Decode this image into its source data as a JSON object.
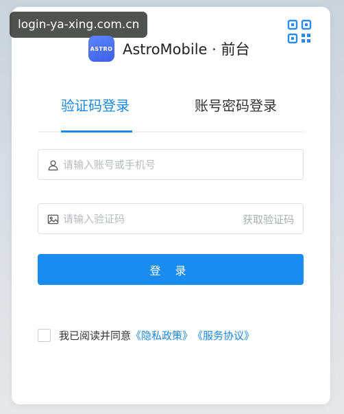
{
  "watermark": "login-ya-xing.com.cn",
  "header": {
    "logo_text": "ASTRO",
    "app_name": "AstroMobile · 前台"
  },
  "tabs": [
    {
      "label": "验证码登录",
      "active": true
    },
    {
      "label": "账号密码登录",
      "active": false
    }
  ],
  "form": {
    "account_placeholder": "请输入账号或手机号",
    "code_placeholder": "请输入验证码",
    "get_code_label": "获取验证码",
    "login_button": "登 录"
  },
  "agreement": {
    "prefix": "我已阅读并同意",
    "privacy_link": "《隐私政策》",
    "service_link": "《服务协议》",
    "checked": false
  },
  "colors": {
    "accent": "#1a88e6",
    "button": "#1a8cf0"
  }
}
